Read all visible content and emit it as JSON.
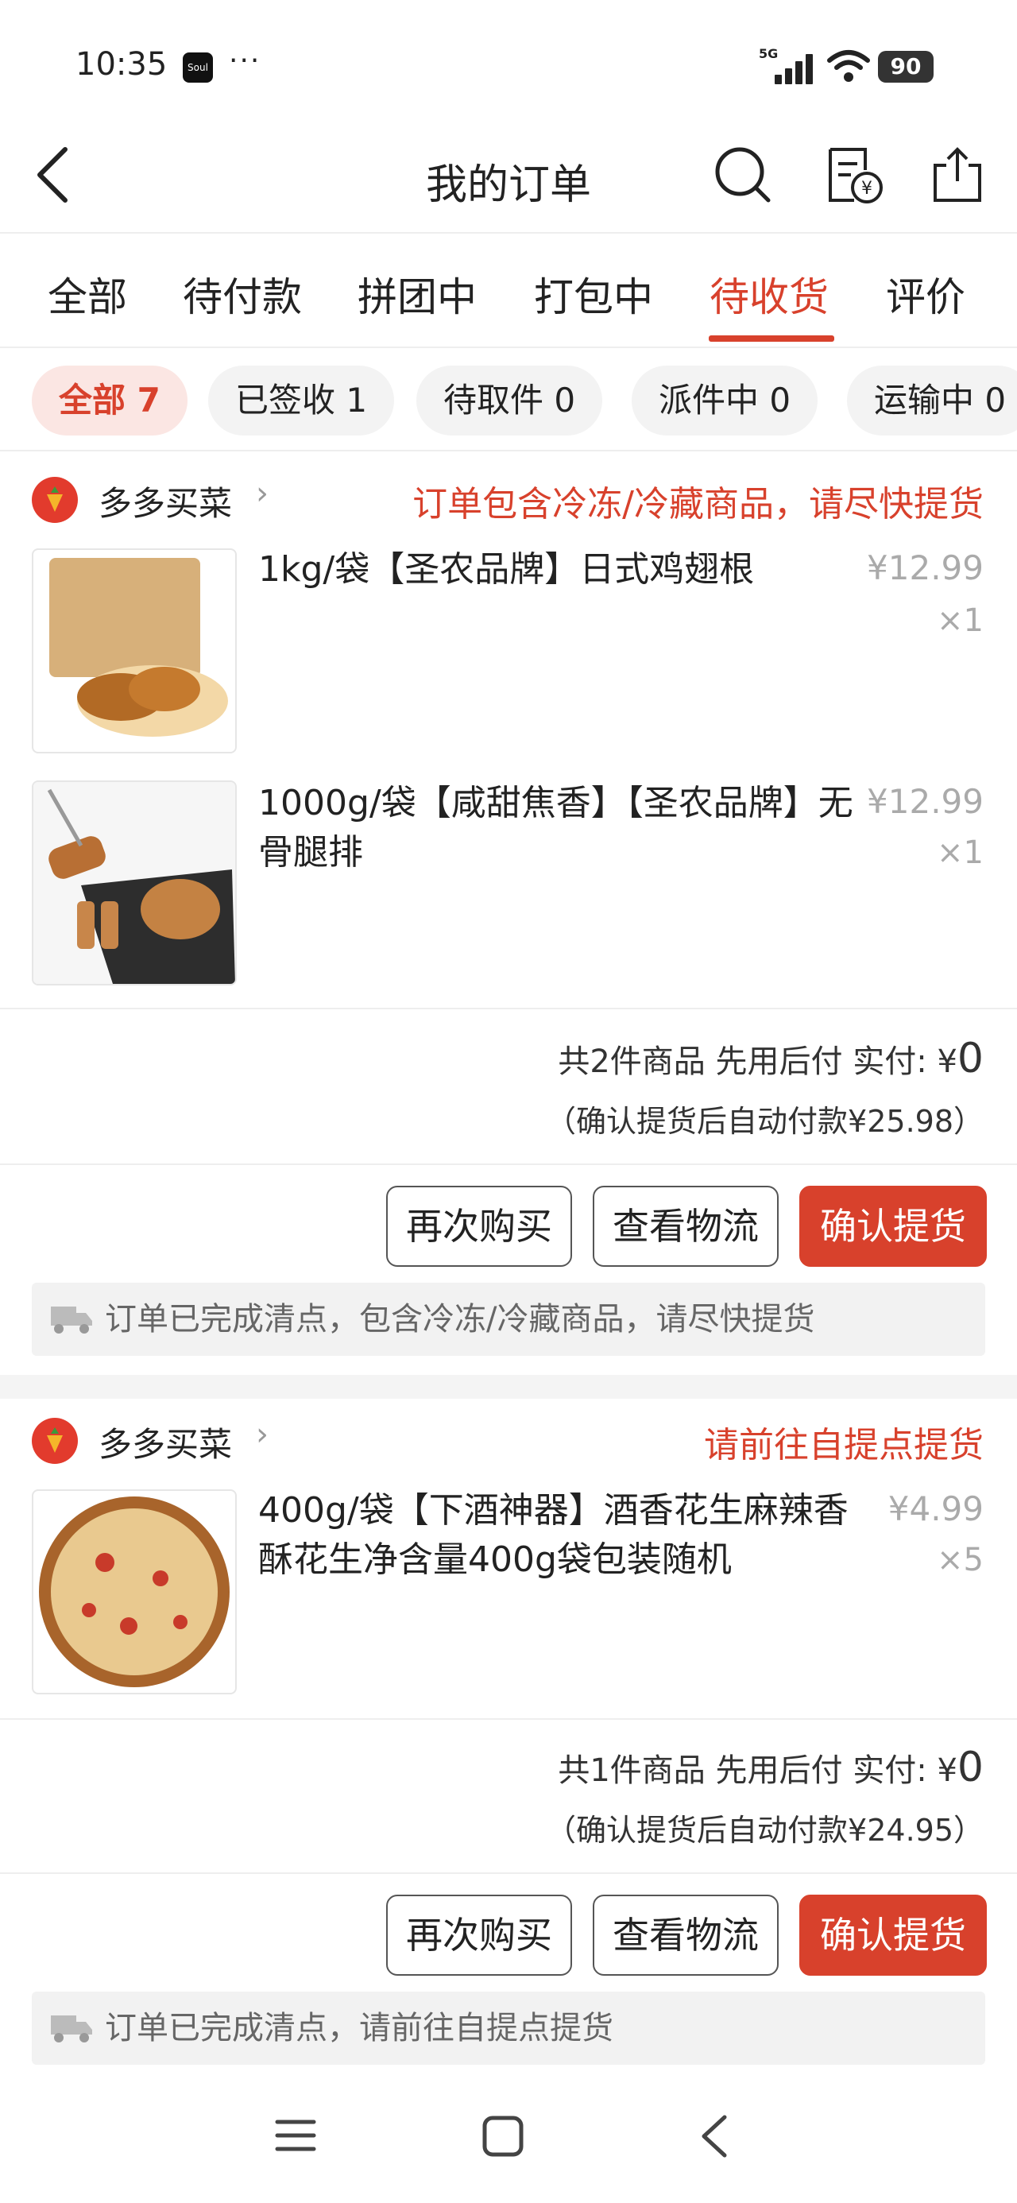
{
  "status_bar": {
    "time": "10:35",
    "app_badge": "Soul",
    "dots": "···",
    "network": "5G",
    "battery": "90"
  },
  "header": {
    "title": "我的订单"
  },
  "tabs": [
    "全部",
    "待付款",
    "拼团中",
    "打包中",
    "待收货",
    "评价"
  ],
  "active_tab": "待收货",
  "chips": [
    {
      "label": "全部 7",
      "active": true
    },
    {
      "label": "已签收 1",
      "active": false
    },
    {
      "label": "待取件 0",
      "active": false
    },
    {
      "label": "派件中 0",
      "active": false
    },
    {
      "label": "运输中 0",
      "active": false
    }
  ],
  "orders": [
    {
      "shop": "多多买菜",
      "note": "订单包含冷冻/冷藏商品，请尽快提货",
      "items": [
        {
          "name": "1kg/袋【圣农品牌】日式鸡翅根",
          "price": "¥12.99",
          "qty": "×1"
        },
        {
          "name_line1": "1000g/袋【咸甜焦香】【圣农品牌】无",
          "name_line2": "骨腿排",
          "price": "¥12.99",
          "qty": "×1"
        }
      ],
      "summary": {
        "count": "共2件商品",
        "pay_later": "先用后付",
        "paid_label": "实付:",
        "currency": "¥",
        "amount": "0"
      },
      "sub": "（确认提货后自动付款¥25.98）",
      "buttons": [
        "再次购买",
        "查看物流",
        "确认提货"
      ],
      "banner": "订单已完成清点，包含冷冻/冷藏商品，请尽快提货"
    },
    {
      "shop": "多多买菜",
      "note": "请前往自提点提货",
      "items": [
        {
          "name_line1": "400g/袋【下酒神器】酒香花生麻辣香",
          "name_line2": "酥花生净含量400g袋包装随机",
          "price": "¥4.99",
          "qty": "×5"
        }
      ],
      "summary": {
        "count": "共1件商品",
        "pay_later": "先用后付",
        "paid_label": "实付:",
        "currency": "¥",
        "amount": "0"
      },
      "sub": "（确认提货后自动付款¥24.95）",
      "buttons": [
        "再次购买",
        "查看物流",
        "确认提货"
      ],
      "banner": "订单已完成清点，请前往自提点提货"
    }
  ],
  "colors": {
    "accent": "#d8412c",
    "chip_active_bg": "#fbe6e3"
  }
}
